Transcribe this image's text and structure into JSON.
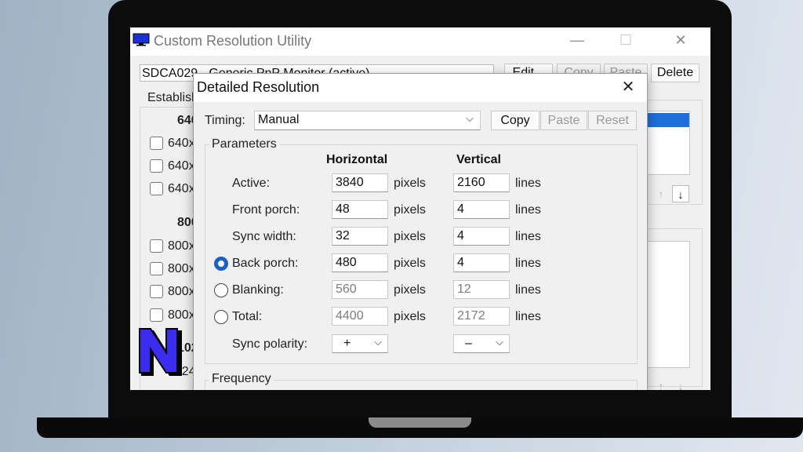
{
  "window": {
    "title": "Custom Resolution Utility",
    "controls": {
      "minimize": "—",
      "maximize": "☐",
      "close": "✕"
    },
    "monitor_select": "SDCA029 - Generic PnP Monitor (active)",
    "buttons": {
      "edit": "Edit...",
      "copy": "Copy",
      "paste": "Paste",
      "delete": "Delete"
    },
    "establish_label": "Establish",
    "left_groups": [
      {
        "heading": "640",
        "items": [
          "640x",
          "640x",
          "640x"
        ]
      },
      {
        "heading": "800",
        "items": [
          "800x",
          "800x",
          "800x",
          "800x"
        ]
      },
      {
        "heading": "102",
        "items": [
          "1024"
        ]
      }
    ]
  },
  "dialog": {
    "title": "Detailed Resolution",
    "close": "✕",
    "timing_label": "Timing:",
    "timing_value": "Manual",
    "buttons": {
      "copy": "Copy",
      "paste": "Paste",
      "reset": "Reset"
    },
    "parameters_label": "Parameters",
    "col_horizontal": "Horizontal",
    "col_vertical": "Vertical",
    "rows": [
      {
        "label": "Active:",
        "h": "3840",
        "h_unit": "pixels",
        "v": "2160",
        "v_unit": "lines",
        "radio": null,
        "readonly": false
      },
      {
        "label": "Front porch:",
        "h": "48",
        "h_unit": "pixels",
        "v": "4",
        "v_unit": "lines",
        "radio": null,
        "readonly": false
      },
      {
        "label": "Sync width:",
        "h": "32",
        "h_unit": "pixels",
        "v": "4",
        "v_unit": "lines",
        "radio": null,
        "readonly": false
      },
      {
        "label": "Back porch:",
        "h": "480",
        "h_unit": "pixels",
        "v": "4",
        "v_unit": "lines",
        "radio": "selected",
        "readonly": false
      },
      {
        "label": "Blanking:",
        "h": "560",
        "h_unit": "pixels",
        "v": "12",
        "v_unit": "lines",
        "radio": "unselected",
        "readonly": true
      },
      {
        "label": "Total:",
        "h": "4400",
        "h_unit": "pixels",
        "v": "2172",
        "v_unit": "lines",
        "radio": "unselected",
        "readonly": true
      }
    ],
    "sync_polarity_label": "Sync polarity:",
    "sync_h": "+",
    "sync_v": "–",
    "frequency_label": "Frequency"
  },
  "icons": {
    "up": "↑",
    "down": "↓",
    "chevron": "⌵"
  },
  "colors": {
    "selection": "#1e6fd9",
    "radio_on": "#1e5fc9",
    "logo_fill": "#3b2cf0"
  }
}
